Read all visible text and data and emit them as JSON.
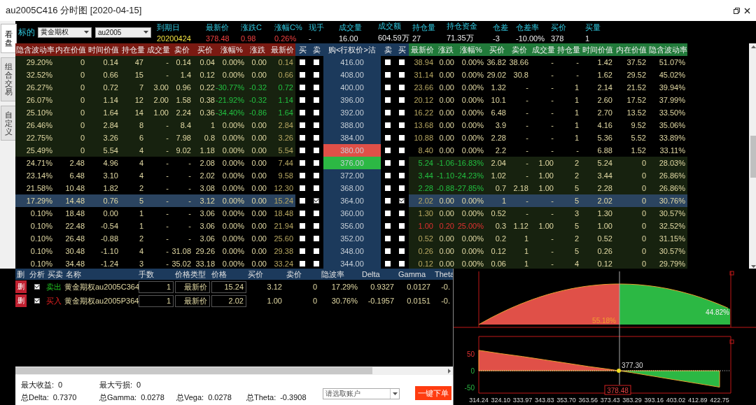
{
  "window": {
    "title": "au2005C416 分时图 [2020-04-15]"
  },
  "side_tabs": [
    {
      "label": "看盘",
      "selected": true
    },
    {
      "label": "组合交易",
      "selected": false
    },
    {
      "label": "自定义",
      "selected": false
    }
  ],
  "quote_bar": {
    "underlying_label": "标的",
    "product": "黄金期权",
    "contract": "au2005",
    "stats": [
      {
        "label": "到期日",
        "value": "20200424",
        "color": "#f0e040"
      },
      {
        "label": "最新价",
        "value": "378.48",
        "color": "#f04040"
      },
      {
        "label": "涨跌C",
        "value": "0.98",
        "color": "#f04040"
      },
      {
        "label": "涨幅C%",
        "value": "0.26%",
        "color": "#f04040"
      },
      {
        "label": "现手",
        "value": "-"
      },
      {
        "label": "成交量",
        "value": "16.00"
      },
      {
        "label": "成交额",
        "value": "604.59万"
      },
      {
        "label": "持仓量",
        "value": "27"
      },
      {
        "label": "持仓资金",
        "value": "71.35万"
      },
      {
        "label": "仓差",
        "value": "-3"
      },
      {
        "label": "仓差率",
        "value": "-10.00%"
      },
      {
        "label": "买价",
        "value": "378"
      },
      {
        "label": "买量",
        "value": "1"
      }
    ]
  },
  "option_table": {
    "call_columns": [
      "隐含波动率",
      "内在价值",
      "时间价值",
      "持仓量",
      "成交量",
      "卖价",
      "买价",
      "涨幅%",
      "涨跌",
      "最新价"
    ],
    "call_checks": [
      "买",
      "卖"
    ],
    "strike_header": "购<行权价>沽",
    "put_checks": [
      "卖",
      "买"
    ],
    "put_columns": [
      "最新价",
      "涨跌",
      "涨幅%",
      "买价",
      "卖价",
      "成交量",
      "持仓量",
      "时间价值",
      "内在价值",
      "隐含波动率"
    ],
    "rows": [
      {
        "call": [
          "29.20%",
          "0",
          "0.14",
          "47",
          "-",
          "0.14",
          "0.04",
          "0.00%",
          "0.00",
          "0.14"
        ],
        "call_itm": true,
        "call_falling": false,
        "call_rising": false,
        "call_buy": false,
        "call_sell": false,
        "strike": "416.00",
        "strike_above": false,
        "strike_below": false,
        "put_sell": false,
        "put_buy": false,
        "put": [
          "38.94",
          "0.00",
          "0.00%",
          "36.82",
          "38.66",
          "-",
          "-",
          "1.42",
          "37.52",
          "51.07%"
        ],
        "put_itm": false,
        "put_falling": false,
        "put_rising": false,
        "selected": false
      },
      {
        "call": [
          "32.52%",
          "0",
          "0.66",
          "15",
          "-",
          "1.4",
          "0.12",
          "0.00%",
          "0.00",
          "0.66"
        ],
        "call_itm": true,
        "call_falling": false,
        "call_rising": false,
        "call_buy": false,
        "call_sell": false,
        "strike": "408.00",
        "strike_above": false,
        "strike_below": false,
        "put_sell": false,
        "put_buy": false,
        "put": [
          "31.14",
          "0.00",
          "0.00%",
          "29.02",
          "30.8",
          "-",
          "-",
          "1.62",
          "29.52",
          "45.02%"
        ],
        "put_itm": false,
        "put_falling": false,
        "put_rising": false,
        "selected": false
      },
      {
        "call": [
          "26.27%",
          "0",
          "0.72",
          "7",
          "3.00",
          "0.96",
          "0.22",
          "-30.77%",
          "-0.32",
          "0.72"
        ],
        "call_itm": true,
        "call_falling": true,
        "call_rising": false,
        "call_buy": false,
        "call_sell": false,
        "strike": "400.00",
        "strike_above": false,
        "strike_below": false,
        "put_sell": false,
        "put_buy": false,
        "put": [
          "23.66",
          "0.00",
          "0.00%",
          "1.32",
          "-",
          "-",
          "1",
          "2.14",
          "21.52",
          "39.94%"
        ],
        "put_itm": false,
        "put_falling": false,
        "put_rising": false,
        "selected": false
      },
      {
        "call": [
          "26.07%",
          "0",
          "1.14",
          "12",
          "2.00",
          "1.58",
          "0.38",
          "-21.92%",
          "-0.32",
          "1.14"
        ],
        "call_itm": true,
        "call_falling": true,
        "call_rising": false,
        "call_buy": false,
        "call_sell": false,
        "strike": "396.00",
        "strike_above": false,
        "strike_below": false,
        "put_sell": false,
        "put_buy": false,
        "put": [
          "20.12",
          "0.00",
          "0.00%",
          "10.1",
          "-",
          "-",
          "1",
          "2.60",
          "17.52",
          "37.99%"
        ],
        "put_itm": false,
        "put_falling": false,
        "put_rising": false,
        "selected": false
      },
      {
        "call": [
          "25.10%",
          "0",
          "1.64",
          "14",
          "1.00",
          "2.24",
          "0.36",
          "-34.40%",
          "-0.86",
          "1.64"
        ],
        "call_itm": true,
        "call_falling": true,
        "call_rising": false,
        "call_buy": false,
        "call_sell": false,
        "strike": "392.00",
        "strike_above": false,
        "strike_below": false,
        "put_sell": false,
        "put_buy": false,
        "put": [
          "16.22",
          "0.00",
          "0.00%",
          "6.48",
          "-",
          "-",
          "1",
          "2.70",
          "13.52",
          "33.50%"
        ],
        "put_itm": false,
        "put_falling": false,
        "put_rising": false,
        "selected": false
      },
      {
        "call": [
          "26.46%",
          "0",
          "2.84",
          "8",
          "-",
          "8.4",
          "1",
          "0.00%",
          "0.00",
          "2.84"
        ],
        "call_itm": true,
        "call_falling": false,
        "call_rising": false,
        "call_buy": false,
        "call_sell": false,
        "strike": "388.00",
        "strike_above": false,
        "strike_below": false,
        "put_sell": false,
        "put_buy": false,
        "put": [
          "13.68",
          "0.00",
          "0.00%",
          "3.9",
          "-",
          "-",
          "1",
          "4.16",
          "9.52",
          "35.06%"
        ],
        "put_itm": false,
        "put_falling": false,
        "put_rising": false,
        "selected": false
      },
      {
        "call": [
          "22.75%",
          "0",
          "3.26",
          "6",
          "-",
          "7.98",
          "0.8",
          "0.00%",
          "0.00",
          "3.26"
        ],
        "call_itm": true,
        "call_falling": false,
        "call_rising": false,
        "call_buy": false,
        "call_sell": false,
        "strike": "384.00",
        "strike_above": false,
        "strike_below": false,
        "put_sell": false,
        "put_buy": false,
        "put": [
          "10.88",
          "0.00",
          "0.00%",
          "2.28",
          "-",
          "-",
          "1",
          "5.36",
          "5.52",
          "33.89%"
        ],
        "put_itm": false,
        "put_falling": false,
        "put_rising": false,
        "selected": false
      },
      {
        "call": [
          "25.49%",
          "0",
          "5.54",
          "4",
          "-",
          "9.02",
          "1.18",
          "0.00%",
          "0.00",
          "5.54"
        ],
        "call_itm": true,
        "call_falling": false,
        "call_rising": false,
        "call_buy": false,
        "call_sell": false,
        "strike": "380.00",
        "strike_above": true,
        "strike_below": false,
        "put_sell": false,
        "put_buy": false,
        "put": [
          "8.40",
          "0.00",
          "0.00%",
          "2.2",
          "-",
          "-",
          "-",
          "6.88",
          "1.52",
          "33.11%"
        ],
        "put_itm": false,
        "put_falling": false,
        "put_rising": false,
        "selected": false
      },
      {
        "call": [
          "24.71%",
          "2.48",
          "4.96",
          "4",
          "-",
          "-",
          "2.08",
          "0.00%",
          "0.00",
          "7.44"
        ],
        "call_itm": false,
        "call_falling": false,
        "call_rising": false,
        "call_buy": false,
        "call_sell": false,
        "strike": "376.00",
        "strike_above": false,
        "strike_below": true,
        "put_sell": false,
        "put_buy": false,
        "put": [
          "5.24",
          "-1.06",
          "-16.83%",
          "2.04",
          "-",
          "1.00",
          "2",
          "5.24",
          "0",
          "28.03%"
        ],
        "put_itm": true,
        "put_falling": true,
        "put_rising": false,
        "selected": false
      },
      {
        "call": [
          "23.14%",
          "6.48",
          "3.10",
          "4",
          "-",
          "-",
          "2.02",
          "0.00%",
          "0.00",
          "9.58"
        ],
        "call_itm": false,
        "call_falling": false,
        "call_rising": false,
        "call_buy": false,
        "call_sell": false,
        "strike": "372.00",
        "strike_above": false,
        "strike_below": false,
        "put_sell": false,
        "put_buy": false,
        "put": [
          "3.44",
          "-1.10",
          "-24.23%",
          "1.02",
          "-",
          "1.00",
          "2",
          "3.44",
          "0",
          "26.86%"
        ],
        "put_itm": true,
        "put_falling": true,
        "put_rising": false,
        "selected": false
      },
      {
        "call": [
          "21.58%",
          "10.48",
          "1.82",
          "2",
          "-",
          "-",
          "3.08",
          "0.00%",
          "0.00",
          "12.30"
        ],
        "call_itm": false,
        "call_falling": false,
        "call_rising": false,
        "call_buy": false,
        "call_sell": false,
        "strike": "368.00",
        "strike_above": false,
        "strike_below": false,
        "put_sell": false,
        "put_buy": false,
        "put": [
          "2.28",
          "-0.88",
          "-27.85%",
          "0.7",
          "2.18",
          "1.00",
          "5",
          "2.28",
          "0",
          "26.86%"
        ],
        "put_itm": true,
        "put_falling": true,
        "put_rising": false,
        "selected": false
      },
      {
        "call": [
          "17.29%",
          "14.48",
          "0.76",
          "5",
          "-",
          "-",
          "3.12",
          "0.00%",
          "0.00",
          "15.24"
        ],
        "call_itm": false,
        "call_falling": false,
        "call_rising": false,
        "call_buy": false,
        "call_sell": true,
        "strike": "364.00",
        "strike_above": false,
        "strike_below": false,
        "put_sell": false,
        "put_buy": true,
        "put": [
          "2.02",
          "0.00",
          "0.00%",
          "1",
          "-",
          "-",
          "5",
          "2.02",
          "0",
          "30.76%"
        ],
        "put_itm": true,
        "put_falling": false,
        "put_rising": false,
        "selected": true
      },
      {
        "call": [
          "0.10%",
          "18.48",
          "0.00",
          "1",
          "-",
          "-",
          "3.06",
          "0.00%",
          "0.00",
          "18.48"
        ],
        "call_itm": false,
        "call_falling": false,
        "call_rising": false,
        "call_buy": false,
        "call_sell": false,
        "strike": "360.00",
        "strike_above": false,
        "strike_below": false,
        "put_sell": false,
        "put_buy": false,
        "put": [
          "1.30",
          "0.00",
          "0.00%",
          "0.52",
          "-",
          "-",
          "3",
          "1.30",
          "0",
          "30.57%"
        ],
        "put_itm": true,
        "put_falling": false,
        "put_rising": false,
        "selected": false
      },
      {
        "call": [
          "0.10%",
          "22.48",
          "-0.54",
          "1",
          "-",
          "-",
          "3.06",
          "0.00%",
          "0.00",
          "21.94"
        ],
        "call_itm": false,
        "call_falling": false,
        "call_rising": false,
        "call_buy": false,
        "call_sell": false,
        "strike": "356.00",
        "strike_above": false,
        "strike_below": false,
        "put_sell": false,
        "put_buy": false,
        "put": [
          "1.00",
          "0.20",
          "25.00%",
          "0.3",
          "1.12",
          "1.00",
          "5",
          "1.00",
          "0",
          "32.52%"
        ],
        "put_itm": true,
        "put_falling": false,
        "put_rising": true,
        "selected": false
      },
      {
        "call": [
          "0.10%",
          "26.48",
          "-0.88",
          "2",
          "-",
          "-",
          "3.06",
          "0.00%",
          "0.00",
          "25.60"
        ],
        "call_itm": false,
        "call_falling": false,
        "call_rising": false,
        "call_buy": false,
        "call_sell": false,
        "strike": "352.00",
        "strike_above": false,
        "strike_below": false,
        "put_sell": false,
        "put_buy": false,
        "put": [
          "0.52",
          "0.00",
          "0.00%",
          "0.2",
          "1",
          "-",
          "2",
          "0.52",
          "0",
          "31.15%"
        ],
        "put_itm": true,
        "put_falling": false,
        "put_rising": false,
        "selected": false
      },
      {
        "call": [
          "0.10%",
          "30.48",
          "-1.10",
          "4",
          "-",
          "31.08",
          "29.26",
          "0.00%",
          "0.00",
          "29.38"
        ],
        "call_itm": false,
        "call_falling": false,
        "call_rising": false,
        "call_buy": false,
        "call_sell": false,
        "strike": "348.00",
        "strike_above": false,
        "strike_below": false,
        "put_sell": false,
        "put_buy": false,
        "put": [
          "0.26",
          "0.00",
          "0.00%",
          "0.12",
          "1",
          "-",
          "5",
          "0.26",
          "0",
          "30.57%"
        ],
        "put_itm": true,
        "put_falling": false,
        "put_rising": false,
        "selected": false
      },
      {
        "call": [
          "0.10%",
          "34.48",
          "-1.24",
          "3",
          "-",
          "35.02",
          "33.18",
          "0.00%",
          "0.00",
          "33.24"
        ],
        "call_itm": false,
        "call_falling": false,
        "call_rising": false,
        "call_buy": false,
        "call_sell": false,
        "strike": "344.00",
        "strike_above": false,
        "strike_below": false,
        "put_sell": false,
        "put_buy": false,
        "put": [
          "0.12",
          "0.00",
          "0.00%",
          "0.06",
          "1",
          "-",
          "4",
          "0.12",
          "0",
          "29.79%"
        ],
        "put_itm": true,
        "put_falling": false,
        "put_rising": false,
        "selected": false
      }
    ]
  },
  "legs_panel": {
    "columns": [
      "删",
      "分析",
      "买卖",
      "名称",
      "手数",
      "价格类型",
      "价格",
      "买价",
      "卖价",
      "隐波率",
      "Delta",
      "Gamma",
      "Theta"
    ],
    "legs": [
      {
        "delete": "删",
        "checked": true,
        "side": "卖出",
        "kind": "sell",
        "name": "黄金期权au2005C364",
        "qty": "1",
        "price_type": "最新价",
        "price": "15.24",
        "bid": "3.12",
        "ask": "0",
        "iv": "17.29%",
        "delta": "0.9327",
        "gamma": "0.0127",
        "theta": "-0."
      },
      {
        "delete": "删",
        "checked": true,
        "side": "买入",
        "kind": "buy",
        "name": "黄金期权au2005P364",
        "qty": "1",
        "price_type": "最新价",
        "price": "2.02",
        "bid": "1.00",
        "ask": "0",
        "iv": "30.76%",
        "delta": "-0.1957",
        "gamma": "0.0151",
        "theta": "-0."
      }
    ]
  },
  "summary": {
    "stats": [
      {
        "label": "最大收益:",
        "value": "0"
      },
      {
        "label": "最大亏损:",
        "value": "0"
      },
      {
        "label": "总Delta:",
        "value": "0.7370"
      },
      {
        "label": "总Gamma:",
        "value": "0.0278"
      },
      {
        "label": "总Vega:",
        "value": "0.0278"
      },
      {
        "label": "总Theta:",
        "value": "-0.3908"
      }
    ],
    "account": {
      "placeholder": "请选取账户"
    },
    "order_button": "一键下单"
  },
  "charts": {
    "probability": {
      "down_share": "55.18%",
      "up_share": "44.82%"
    },
    "payoff": {
      "breakeven": "377.30",
      "price": "378.48",
      "chart_data": {
        "type": "area",
        "x": [
          314.24,
          324.1,
          333.97,
          343.83,
          353.7,
          363.56,
          373.43,
          377.3,
          383.29,
          393.16,
          403.02,
          412.89,
          422.75
        ],
        "series": [
          {
            "color": "#e05048",
            "values": [
              62,
              52,
              43,
              33,
              23,
              13,
              4,
              0,
              null,
              null,
              null,
              null,
              null
            ]
          },
          {
            "color": "#2cb844",
            "values": [
              null,
              null,
              null,
              null,
              null,
              null,
              null,
              0,
              -6,
              -17,
              -28,
              -39,
              -50
            ]
          }
        ],
        "xticks": [
          {
            "value": 314.24,
            "label": "314.24"
          },
          {
            "value": 324.1,
            "label": "324.10"
          },
          {
            "value": 333.97,
            "label": "333.97"
          },
          {
            "value": 343.83,
            "label": "343.83"
          },
          {
            "value": 353.7,
            "label": "353.70"
          },
          {
            "value": 363.56,
            "label": "363.56"
          },
          {
            "value": 373.43,
            "label": "373.43"
          },
          {
            "value": 383.29,
            "label": "383.29"
          },
          {
            "value": 393.16,
            "label": "393.16"
          },
          {
            "value": 403.02,
            "label": "403.02"
          },
          {
            "value": 412.89,
            "label": "412.89"
          },
          {
            "value": 422.75,
            "label": "422.75"
          }
        ],
        "xlim": [
          314.24,
          427.8
        ],
        "ylim": [
          -68,
          104
        ],
        "yticks": [
          50,
          0,
          -50
        ]
      }
    }
  }
}
